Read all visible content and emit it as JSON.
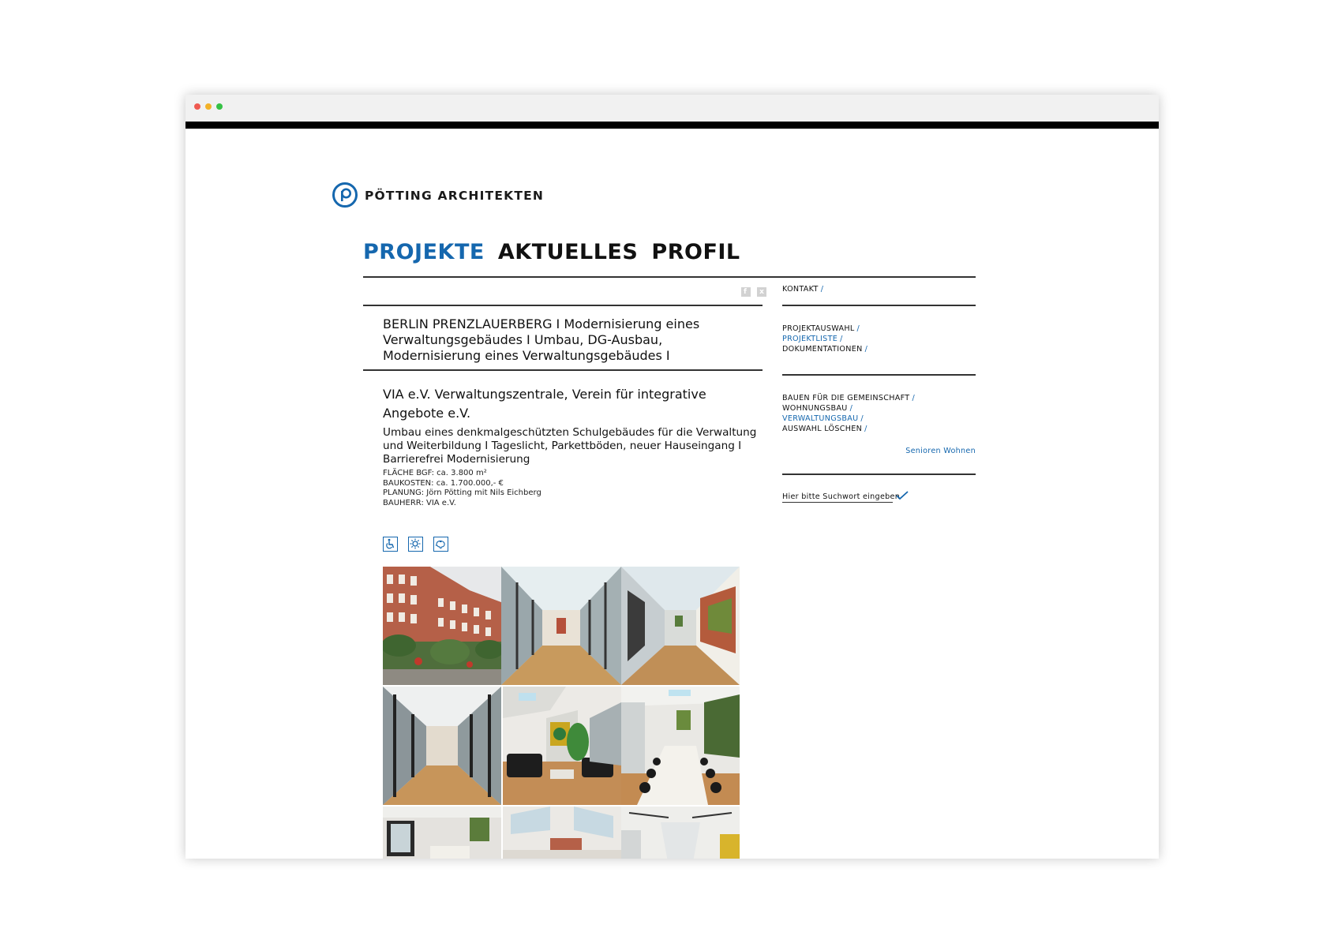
{
  "brand": {
    "name": "PÖTTING ARCHITEKTEN",
    "accent_color": "#1567ae"
  },
  "nav": {
    "items": [
      {
        "label": "PROJEKTE",
        "active": true
      },
      {
        "label": "AKTUELLES",
        "active": false
      },
      {
        "label": "PROFIL",
        "active": false
      }
    ]
  },
  "social": {
    "facebook": "f",
    "xing": "x"
  },
  "project": {
    "title": "BERLIN PRENZLAUERBERG I Modernisierung eines Verwaltungsgebäudes I Umbau, DG-Ausbau, Modernisierung eines Verwaltungsgebäudes I",
    "subtitle": "VIA e.V. Verwaltungszentrale, Verein für integrative Angebote e.V.",
    "description": "Umbau eines denkmalgeschützten Schulgebäudes für die Verwaltung und Weiterbildung I Tageslicht, Parkettböden, neuer Hauseingang I Barrierefrei Modernisierung",
    "facts": [
      "FLÄCHE BGF: ca. 3.800 m²",
      "BAUKOSTEN: ca. 1.700.000,- €",
      "PLANUNG: Jörn Pötting mit Nils Eichberg",
      "BAUHERR: VIA e.V."
    ],
    "feature_icons": [
      "wheelchair-icon",
      "daylight-icon",
      "savings-icon"
    ]
  },
  "sidebar": {
    "contact": "KONTAKT",
    "project_nav": [
      {
        "label": "PROJEKTAUSWAHL",
        "active": false
      },
      {
        "label": "PROJEKTLISTE",
        "active": true
      },
      {
        "label": "DOKUMENTATIONEN",
        "active": false
      }
    ],
    "categories": [
      {
        "label": "BAUEN FÜR DIE GEMEINSCHAFT",
        "active": false
      },
      {
        "label": "WOHNUNGSBAU",
        "active": false
      },
      {
        "label": "VERWALTUNGSBAU",
        "active": true
      },
      {
        "label": "AUSWAHL LÖSCHEN",
        "active": false
      }
    ],
    "tag_link": "Senioren Wohnen",
    "search_placeholder": "Hier bitte Suchwort eingeben",
    "separator": "/"
  }
}
